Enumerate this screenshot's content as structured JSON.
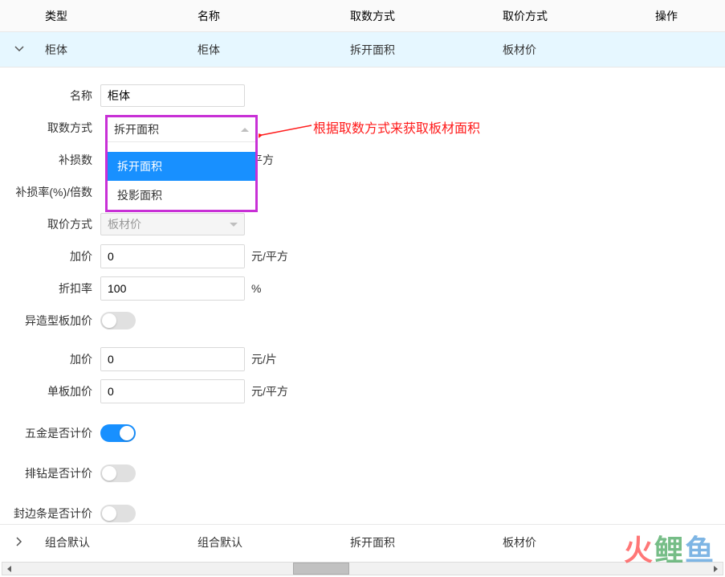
{
  "columns": {
    "type": "类型",
    "name": "名称",
    "method": "取数方式",
    "price": "取价方式",
    "op": "操作"
  },
  "row1": {
    "type": "柜体",
    "name": "柜体",
    "method": "拆开面积",
    "price": "板材价"
  },
  "row2": {
    "type": "组合默认",
    "name": "组合默认",
    "method": "拆开面积",
    "price": "板材价"
  },
  "form": {
    "name_label": "名称",
    "name_value": "柜体",
    "method_label": "取数方式",
    "method_value": "拆开面积",
    "loss_label": "补损数",
    "loss_unit": "平方",
    "lossrate_label": "补损率(%)/倍数",
    "price_label": "取价方式",
    "price_value": "板材价",
    "addprice_label": "加价",
    "addprice_value": "0",
    "addprice_unit": "元/平方",
    "discount_label": "折扣率",
    "discount_value": "100",
    "discount_unit": "%",
    "special_label": "异造型板加价",
    "addprice2_label": "加价",
    "addprice2_value": "0",
    "addprice2_unit": "元/片",
    "single_label": "单板加价",
    "single_value": "0",
    "single_unit": "元/平方",
    "hardware_label": "五金是否计价",
    "drill_label": "排钻是否计价",
    "edge_label": "封边条是否计价"
  },
  "dropdown": {
    "selected": "拆开面积",
    "opt1": "拆开面积",
    "opt2": "投影面积"
  },
  "annotation": "根据取数方式来获取板材面积",
  "watermark": {
    "c1": "火",
    "c2": "鲤",
    "c3": "鱼"
  }
}
